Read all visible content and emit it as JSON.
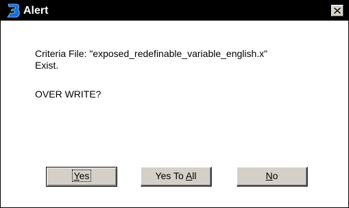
{
  "window": {
    "title": "Alert",
    "title_bar_color": "#000000"
  },
  "message": {
    "line1": "Criteria File: \"exposed_redefinable_variable_english.x\"",
    "line2": "Exist.",
    "line3": "OVER WRITE?"
  },
  "buttons": {
    "yes": {
      "pre": "",
      "mnemonic": "Y",
      "post": "es"
    },
    "yes_to_all": {
      "pre": "Yes To ",
      "mnemonic": "A",
      "post": "ll"
    },
    "no": {
      "pre": "",
      "mnemonic": "N",
      "post": "o"
    }
  },
  "icons": {
    "app": "bentley-b-icon",
    "close": "close-icon"
  },
  "colors": {
    "button_face": "#d4d0c8",
    "background": "#ffffff",
    "icon_blue": "#1a6fd6"
  }
}
